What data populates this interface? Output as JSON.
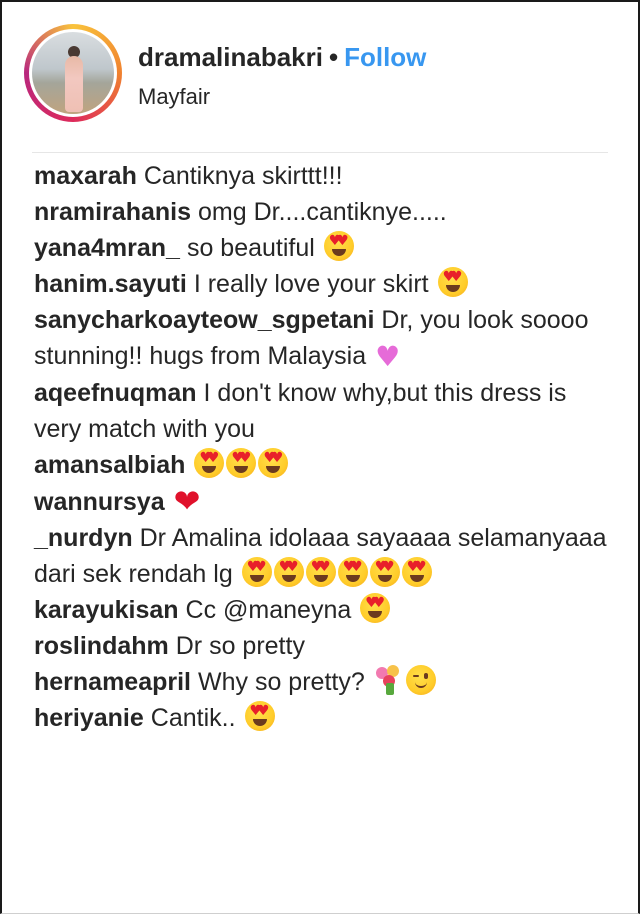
{
  "post": {
    "username": "dramalinabakri",
    "separator": "•",
    "follow_label": "Follow",
    "location": "Mayfair"
  },
  "comments": [
    {
      "user": "maxarah",
      "text": "Cantiknya skirttt!!!"
    },
    {
      "user": "nramirahanis",
      "text": "omg Dr....cantiknye....."
    },
    {
      "user": "yana4mran_",
      "text": "so beautiful",
      "emojis": [
        "smiling-face-with-heart-eyes"
      ]
    },
    {
      "user": "hanim.sayuti",
      "text": "I really love your skirt",
      "emojis": [
        "smiling-face-with-heart-eyes"
      ]
    },
    {
      "user": "sanycharkoayteow_sgpetani",
      "text": "Dr, you look soooo stunning!! hugs from Malaysia",
      "emojis": [
        "sparkling-heart"
      ]
    },
    {
      "user": "aqeefnuqman",
      "text": "I don't know why,but this dress is very match with you"
    },
    {
      "user": "amansalbiah",
      "text": "",
      "emojis": [
        "smiling-face-with-heart-eyes",
        "smiling-face-with-heart-eyes",
        "smiling-face-with-heart-eyes"
      ]
    },
    {
      "user": "wannursya",
      "text": "",
      "emojis": [
        "red-heart"
      ]
    },
    {
      "user": "_nurdyn",
      "text": "Dr Amalina idolaaa sayaaaa selamanyaaa dari sek rendah lg",
      "emojis": [
        "smiling-face-with-heart-eyes",
        "smiling-face-with-heart-eyes",
        "smiling-face-with-heart-eyes",
        "smiling-face-with-heart-eyes",
        "smiling-face-with-heart-eyes",
        "smiling-face-with-heart-eyes"
      ]
    },
    {
      "user": "karayukisan",
      "text": "Cc @maneyna",
      "emojis": [
        "smiling-face-with-heart-eyes"
      ]
    },
    {
      "user": "roslindahm",
      "text": "Dr so pretty"
    },
    {
      "user": "hernameapril",
      "text": "Why so pretty?",
      "emojis": [
        "bouquet",
        "winking-face"
      ]
    },
    {
      "user": "heriyanie",
      "text": "Cantik..",
      "emojis": [
        "smiling-face-with-heart-eyes"
      ]
    }
  ],
  "colors": {
    "follow": "#3897f0",
    "text": "#262626",
    "divider": "#e6e6e6"
  }
}
